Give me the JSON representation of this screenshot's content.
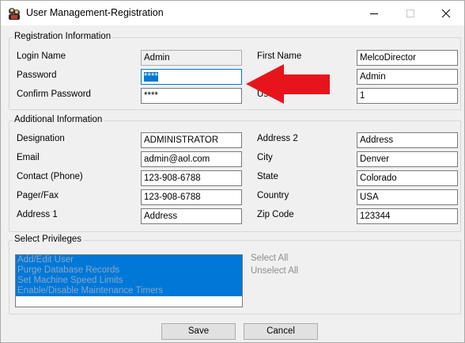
{
  "window": {
    "title": "User Management-Registration",
    "controls": {
      "minimize": "minimize",
      "maximize": "maximize",
      "close": "close"
    }
  },
  "registration": {
    "group_title": "Registration Information",
    "login_name_label": "Login Name",
    "login_name_value": "Admin",
    "password_label": "Password",
    "password_value": "****",
    "confirm_password_label": "Confirm Password",
    "confirm_password_value": "****",
    "first_name_label": "First Name",
    "first_name_value": "MelcoDirector",
    "last_name_value": "Admin",
    "user_label_partial": "Use",
    "user_value": "1"
  },
  "additional": {
    "group_title": "Additional Information",
    "designation_label": "Designation",
    "designation_value": "ADMINISTRATOR",
    "email_label": "Email",
    "email_value": "admin@aol.com",
    "contact_label": "Contact (Phone)",
    "contact_value": "123-908-6788",
    "pager_label": "Pager/Fax",
    "pager_value": "123-908-6788",
    "address1_label": "Address 1",
    "address1_value": "Address",
    "address2_label": "Address 2",
    "address2_value": "Address",
    "city_label": "City",
    "city_value": "Denver",
    "state_label": "State",
    "state_value": "Colorado",
    "country_label": "Country",
    "country_value": "USA",
    "zip_label": "Zip Code",
    "zip_value": "123344"
  },
  "privileges": {
    "group_title": "Select Privileges",
    "items": [
      "Add/Edit User",
      "Purge Database Records",
      "Set Machine Speed Limits",
      "Enable/Disable Maintenance Timers"
    ],
    "select_all": "Select All",
    "unselect_all": "Unselect All"
  },
  "buttons": {
    "save": "Save",
    "cancel": "Cancel"
  },
  "colors": {
    "selection": "#0078d7",
    "arrow": "#e8141c",
    "dialog_bg": "#f0f0f0"
  },
  "icons": {
    "app": "app-icon",
    "arrow": "red-arrow-annotation"
  }
}
